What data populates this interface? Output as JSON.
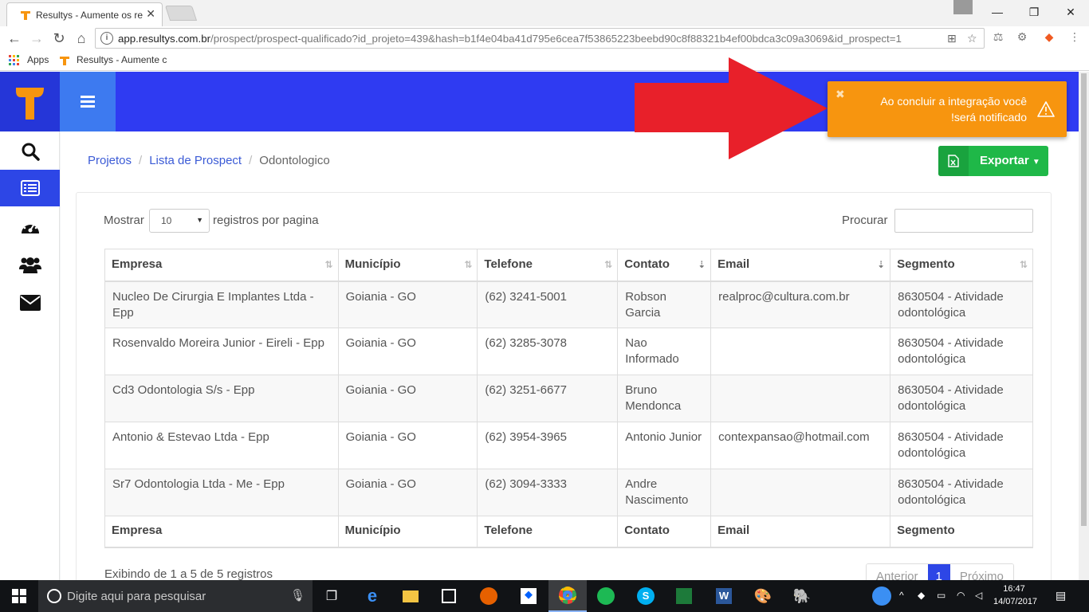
{
  "browser": {
    "tab_title": "Resultys - Aumente os re",
    "url_host": "app.resultys.com.br",
    "url_path": "/prospect/prospect-qualificado?id_projeto=439&hash=b1f4e04ba41d795e6cea7f53865223beebd90c8f88321b4ef00bdca3c09a3069&id_prospect=1",
    "bookmarks": [
      "Apps",
      "Resultys - Aumente c"
    ]
  },
  "breadcrumb": [
    "Projetos",
    "Lista de Prospect",
    "Odontologico"
  ],
  "export_label": "Exportar",
  "table_controls": {
    "show_label": "Mostrar",
    "page_size": "10",
    "per_page_label": "registros por pagina",
    "search_label": "Procurar"
  },
  "columns": [
    "Empresa",
    "Município",
    "Telefone",
    "Contato",
    "Email",
    "Segmento"
  ],
  "rows": [
    {
      "empresa": "Nucleo De Cirurgia E Implantes Ltda - Epp",
      "municipio": "Goiania - GO",
      "telefone": "(62) 3241-5001",
      "contato": "Robson Garcia",
      "email": "realproc@cultura.com.br",
      "segmento": "8630504 - Atividade odontológica"
    },
    {
      "empresa": "Rosenvaldo Moreira Junior - Eireli - Epp",
      "municipio": "Goiania - GO",
      "telefone": "(62) 3285-3078",
      "contato": "Nao Informado",
      "email": "",
      "segmento": "8630504 - Atividade odontológica"
    },
    {
      "empresa": "Cd3 Odontologia S/s - Epp",
      "municipio": "Goiania - GO",
      "telefone": "(62) 3251-6677",
      "contato": "Bruno Mendonca",
      "email": "",
      "segmento": "8630504 - Atividade odontológica"
    },
    {
      "empresa": "Antonio & Estevao Ltda - Epp",
      "municipio": "Goiania - GO",
      "telefone": "(62) 3954-3965",
      "contato": "Antonio Junior",
      "email": "contexpansao@hotmail.com",
      "segmento": "8630504 - Atividade odontológica"
    },
    {
      "empresa": "Sr7 Odontologia Ltda - Me - Epp",
      "municipio": "Goiania - GO",
      "telefone": "(62) 3094-3333",
      "contato": "Andre Nascimento",
      "email": "",
      "segmento": "8630504 - Atividade odontológica"
    }
  ],
  "info_text": "Exibindo de 1 a 5 de 5 registros",
  "pagination": {
    "prev": "Anterior",
    "current": "1",
    "next": "Próximo"
  },
  "toast": {
    "line1": "Ao concluir a integração você",
    "line2": "!será notificado"
  },
  "taskbar": {
    "search_placeholder": "Digite aqui para pesquisar",
    "time": "16:47",
    "date": "14/07/2017"
  },
  "colors": {
    "brand_blue": "#2f3bf2",
    "brand_orange": "#f7950f",
    "export_green": "#1fb848"
  }
}
